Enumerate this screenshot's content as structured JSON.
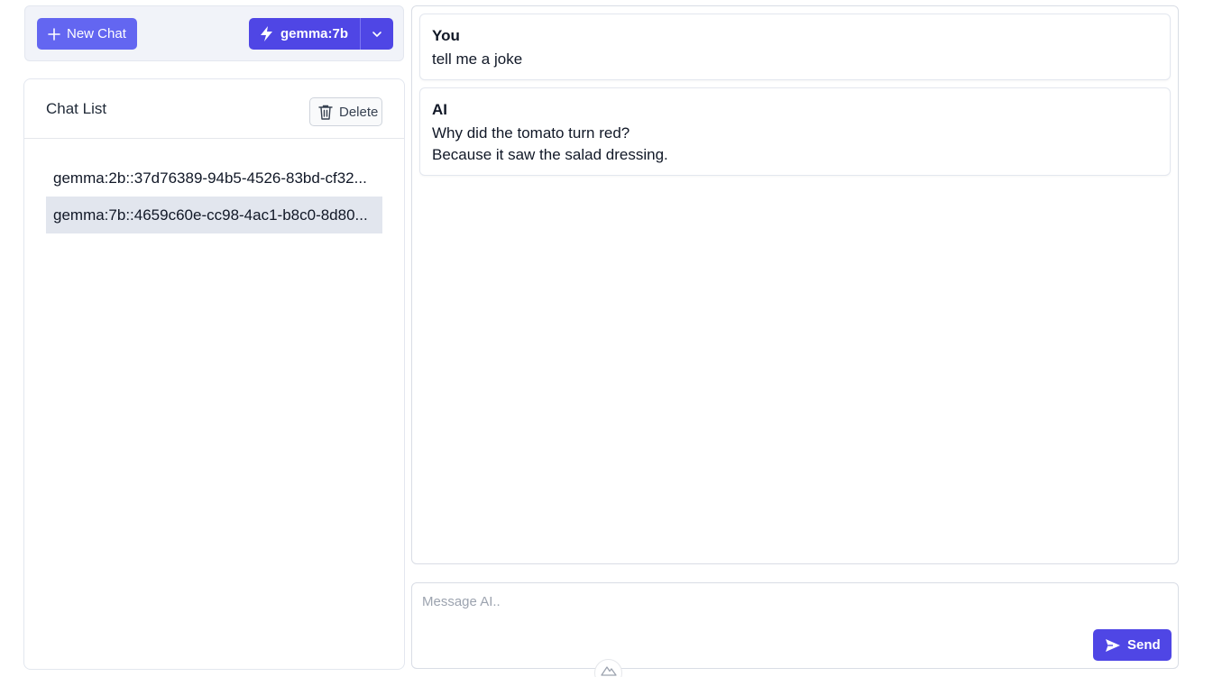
{
  "toolbar": {
    "new_chat_label": "New Chat",
    "model_label": "gemma:7b",
    "icons": {
      "new_chat": "plus-icon",
      "model": "lightning-icon",
      "dropdown": "chevron-down-icon"
    }
  },
  "chat_list": {
    "title": "Chat List",
    "delete_label": "Delete",
    "items": [
      {
        "label": "gemma:2b::37d76389-94b5-4526-83bd-cf32...",
        "active": false
      },
      {
        "label": "gemma:7b::4659c60e-cc98-4ac1-b8c0-8d80...",
        "active": true
      }
    ]
  },
  "messages": [
    {
      "author": "You",
      "lines": [
        "tell me a joke"
      ]
    },
    {
      "author": "AI",
      "lines": [
        "Why did the tomato turn red?",
        "Because it saw the salad dressing."
      ]
    }
  ],
  "composer": {
    "placeholder": "Message AI..",
    "value": "",
    "send_label": "Send"
  },
  "colors": {
    "primary": "#4f46e5",
    "primary_light": "#6366f1",
    "active_item_bg": "#e2e6ee",
    "toolbar_bg": "#f1f3f9"
  }
}
